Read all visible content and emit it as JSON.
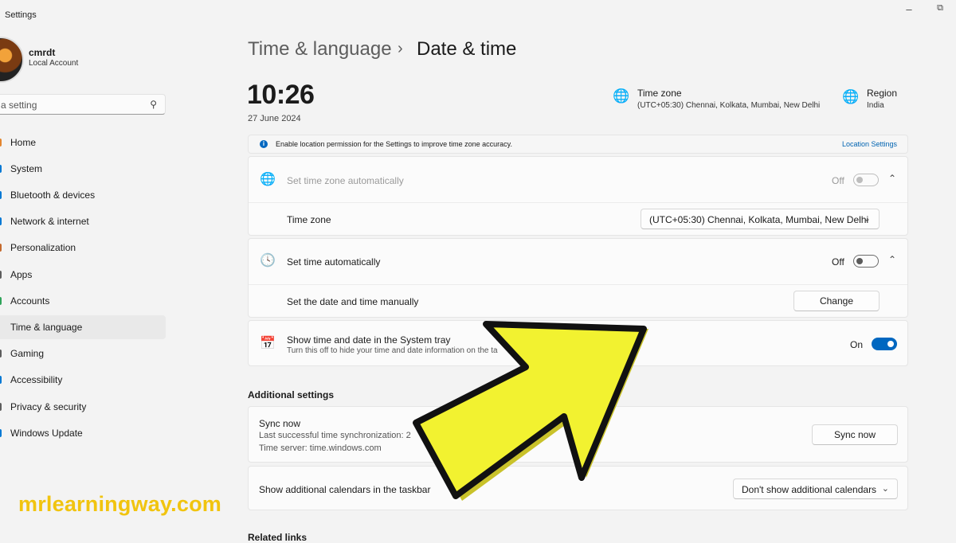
{
  "window": {
    "title": "Settings",
    "minimize_glyph": "–",
    "restore_glyph": "⧉"
  },
  "user": {
    "name": "cmrdt",
    "account_type": "Local Account"
  },
  "search": {
    "placeholder": "d a setting"
  },
  "sidebar": {
    "items": [
      {
        "label": "Home",
        "icon": "home-icon",
        "color": "#e3852e"
      },
      {
        "label": "System",
        "icon": "system-icon",
        "color": "#0078d4"
      },
      {
        "label": "Bluetooth & devices",
        "icon": "bluetooth-icon",
        "color": "#0078d4"
      },
      {
        "label": "Network & internet",
        "icon": "network-icon",
        "color": "#0078d4"
      },
      {
        "label": "Personalization",
        "icon": "brush-icon",
        "color": "#c46a2e"
      },
      {
        "label": "Apps",
        "icon": "apps-icon",
        "color": "#5d5d5d"
      },
      {
        "label": "Accounts",
        "icon": "accounts-icon",
        "color": "#2fa35a"
      },
      {
        "label": "Time & language",
        "icon": "globe-clock-icon",
        "color": "#0078d4",
        "active": true
      },
      {
        "label": "Gaming",
        "icon": "gaming-icon",
        "color": "#5d5d5d"
      },
      {
        "label": "Accessibility",
        "icon": "accessibility-icon",
        "color": "#0078d4"
      },
      {
        "label": "Privacy & security",
        "icon": "shield-icon",
        "color": "#5d5d5d"
      },
      {
        "label": "Windows Update",
        "icon": "update-icon",
        "color": "#0078d4"
      }
    ]
  },
  "header": {
    "parent": "Time & language",
    "separator": "›",
    "current": "Date & time"
  },
  "clock": {
    "time": "10:26",
    "date": "27 June 2024"
  },
  "timezone_info": {
    "label": "Time zone",
    "value": "(UTC+05:30) Chennai, Kolkata, Mumbai, New Delhi"
  },
  "region_info": {
    "label": "Region",
    "value": "India"
  },
  "info_bar": {
    "text": "Enable location permission for the Settings to improve time zone accuracy.",
    "link": "Location Settings"
  },
  "settings": {
    "tz_auto": {
      "label": "Set time zone automatically",
      "state": "Off"
    },
    "time_zone": {
      "label": "Time zone",
      "value": "(UTC+05:30) Chennai, Kolkata, Mumbai, New Delhi"
    },
    "time_auto": {
      "label": "Set time automatically",
      "state": "Off"
    },
    "manual": {
      "label": "Set the date and time manually",
      "button": "Change"
    },
    "systray": {
      "label": "Show time and date in the System tray",
      "sub": "Turn this off to hide your time and date information on the ta",
      "state": "On"
    }
  },
  "additional": {
    "heading": "Additional settings",
    "sync": {
      "title": "Sync now",
      "last": "Last successful time synchronization: 2",
      "server": "Time server: time.windows.com",
      "button": "Sync now"
    },
    "calendars": {
      "label": "Show additional calendars in the taskbar",
      "value": "Don't show additional calendars"
    }
  },
  "related": {
    "heading": "Related links"
  },
  "watermark": "mrlearningway.com",
  "colors": {
    "accent": "#0067c0",
    "arrow_fill": "#f2f230",
    "arrow_shadow": "#c9c22a",
    "watermark": "#f1c40f"
  }
}
